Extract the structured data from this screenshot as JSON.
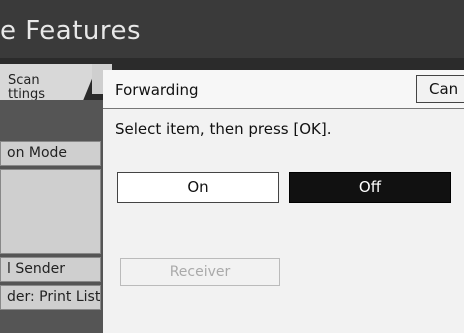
{
  "title": "e Features",
  "tabs": {
    "scan_line1": "Scan",
    "scan_line2": "ttings"
  },
  "left_menu": {
    "item1": "on Mode",
    "item2": "l Sender",
    "item3": "der: Print List"
  },
  "dialog": {
    "title": "Forwarding",
    "cancel_label": "Can",
    "instruction": "Select item, then press [OK].",
    "options": {
      "on_label": "On",
      "off_label": "Off",
      "selected": "Off"
    },
    "receiver_label": "Receiver"
  },
  "colors": {
    "background": "#2b2b2b",
    "dialog_bg": "#f2f2f2",
    "selected_bg": "#111111",
    "disabled_text": "#aaaaaa"
  }
}
